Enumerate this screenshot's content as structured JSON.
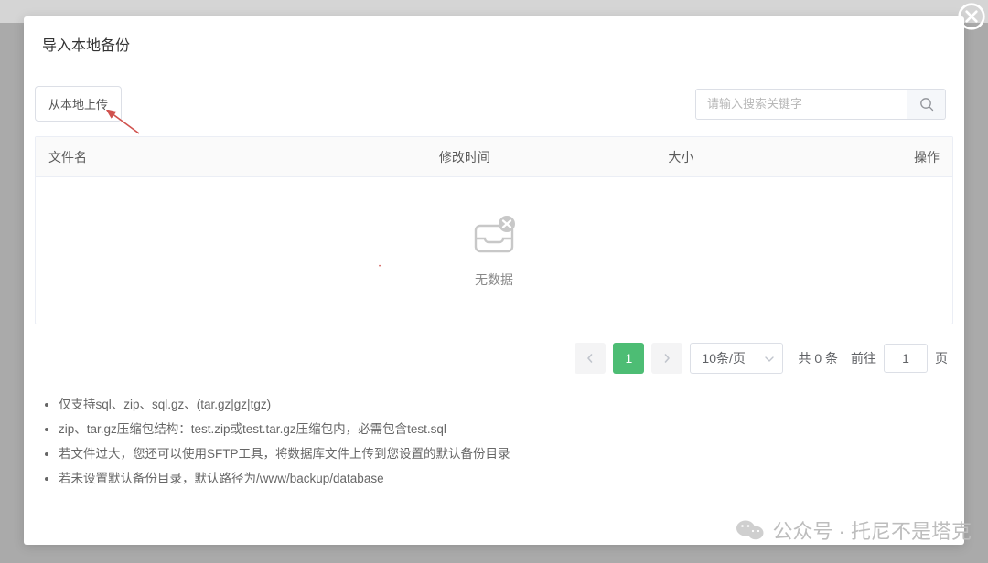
{
  "dialog": {
    "title": "导入本地备份"
  },
  "toolbar": {
    "upload_label": "从本地上传"
  },
  "search": {
    "placeholder": "请输入搜索关键字"
  },
  "table": {
    "headers": {
      "name": "文件名",
      "mtime": "修改时间",
      "size": "大小",
      "ops": "操作"
    },
    "empty_text": "无数据",
    "rows": []
  },
  "pagination": {
    "current": "1",
    "page_size_label": "10条/页",
    "total_prefix": "共",
    "total_count": "0",
    "total_suffix": "条",
    "goto_label": "前往",
    "goto_value": "1",
    "goto_unit": "页"
  },
  "notes": {
    "items": [
      "仅支持sql、zip、sql.gz、(tar.gz|gz|tgz)",
      "zip、tar.gz压缩包结构：test.zip或test.tar.gz压缩包内，必需包含test.sql",
      "若文件过大，您还可以使用SFTP工具，将数据库文件上传到您设置的默认备份目录",
      "若未设置默认备份目录，默认路径为/www/backup/database"
    ]
  },
  "watermark": {
    "text": "公众号 · 托尼不是塔克"
  }
}
